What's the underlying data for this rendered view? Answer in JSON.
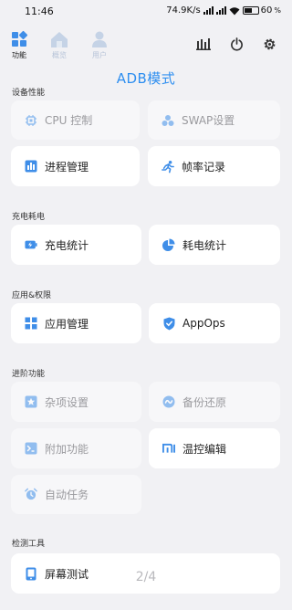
{
  "status_bar": {
    "time": "11:46",
    "speed": "74.9K/s",
    "battery": "60"
  },
  "nav": {
    "tabs": [
      {
        "label": "功能",
        "active": true
      },
      {
        "label": "概览",
        "active": false
      },
      {
        "label": "用户",
        "active": false
      }
    ],
    "tools": [
      "chart-icon",
      "power-icon",
      "settings-icon"
    ]
  },
  "mode_label": "ADB模式",
  "sections": {
    "perf": "设备性能",
    "charge": "充电耗电",
    "apps": "应用&权限",
    "advanced": "进阶功能",
    "test": "检测工具"
  },
  "cards": {
    "cpu": "CPU 控制",
    "swap": "SWAP设置",
    "process": "进程管理",
    "fps": "帧率记录",
    "charge_stats": "充电统计",
    "power_stats": "耗电统计",
    "app_manage": "应用管理",
    "appops": "AppOps",
    "misc": "杂项设置",
    "backup": "备份还原",
    "addon": "附加功能",
    "remote": "温控编辑",
    "auto_task": "自动任务",
    "screen_test": "屏幕测试"
  },
  "pager": "2/4",
  "colors": {
    "accent": "#2f8ff0",
    "bg": "#f1f1f4",
    "card": "#ffffff"
  }
}
